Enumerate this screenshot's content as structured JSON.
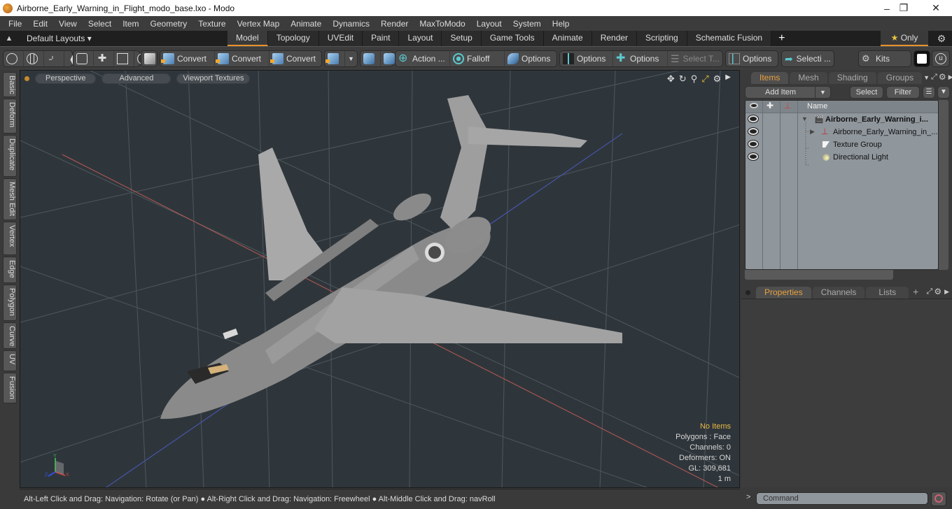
{
  "window": {
    "title": "Airborne_Early_Warning_in_Flight_modo_base.lxo - Modo",
    "controls": [
      "minimize",
      "maximize",
      "close"
    ]
  },
  "menu": [
    "File",
    "Edit",
    "View",
    "Select",
    "Item",
    "Geometry",
    "Texture",
    "Vertex Map",
    "Animate",
    "Dynamics",
    "Render",
    "MaxToModo",
    "Layout",
    "System",
    "Help"
  ],
  "layout_bar": {
    "layouts_label": "Default Layouts ▾",
    "tabs": [
      "Model",
      "Topology",
      "UVEdit",
      "Paint",
      "Layout",
      "Setup",
      "Game Tools",
      "Animate",
      "Render",
      "Scripting",
      "Schematic Fusion"
    ],
    "active_tab": "Model",
    "add_tab": "+",
    "only_label": "Only",
    "accent": "#e8922c"
  },
  "toolbar": {
    "convert_1": "Convert",
    "convert_2": "Convert",
    "convert_3": "Convert",
    "action": "Action",
    "action_more": "...",
    "falloff": "Falloff",
    "options_1": "Options",
    "options_2": "Options",
    "options_3": "Options",
    "select_t": "Select T...",
    "options_4": "Options",
    "selecti": "Selecti ...",
    "kits": "Kits"
  },
  "left_tabs": [
    "Basic",
    "Deform",
    "Duplicate",
    "Mesh Edit",
    "Vertex",
    "Edge",
    "Polygon",
    "Curve",
    "UV",
    "Fusion"
  ],
  "viewport": {
    "view_mode": "Perspective",
    "shading": "Advanced",
    "textures": "Viewport Textures",
    "info": {
      "selection": "No Items",
      "polygons": "Polygons : Face",
      "channels": "Channels: 0",
      "deformers": "Deformers: ON",
      "gl": "GL: 309,681",
      "scale": "1 m"
    },
    "gizmo": {
      "x": "X",
      "y": "Y",
      "z": "Z"
    }
  },
  "status": {
    "hint": "Alt-Left Click and Drag: Navigation: Rotate (or Pan) ● Alt-Right Click and Drag: Navigation: Freewheel ● Alt-Middle Click and Drag: navRoll"
  },
  "items_panel": {
    "tabs": [
      "Items",
      "Mesh ...",
      "Shading",
      "Groups"
    ],
    "active_tab": "Items",
    "add_item": "Add Item",
    "select": "Select",
    "filter": "Filter",
    "column_name": "Name",
    "rows": [
      {
        "name": "Airborne_Early_Warning_i...",
        "type": "scene",
        "bold": true
      },
      {
        "name": "Airborne_Early_Warning_in_...",
        "type": "mesh"
      },
      {
        "name": "Texture Group",
        "type": "texture-group"
      },
      {
        "name": "Directional Light",
        "type": "light"
      }
    ]
  },
  "properties_panel": {
    "tabs": [
      "Properties",
      "Channels",
      "Lists"
    ],
    "active_tab": "Properties",
    "add": "+"
  },
  "command": {
    "prompt": ">",
    "placeholder": "Command"
  }
}
